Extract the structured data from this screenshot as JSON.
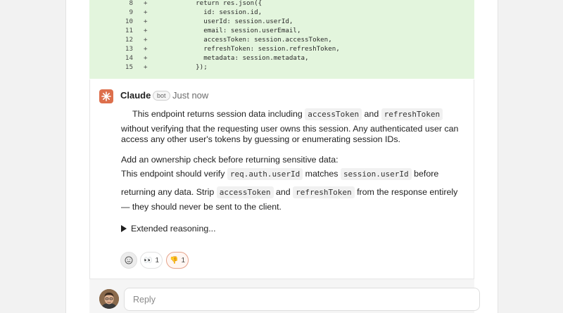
{
  "diff": {
    "lines": [
      {
        "num": "8",
        "sign": "+",
        "code": "    return res.json({"
      },
      {
        "num": "9",
        "sign": "+",
        "code": "      id: session.id,"
      },
      {
        "num": "10",
        "sign": "+",
        "code": "      userId: session.userId,"
      },
      {
        "num": "11",
        "sign": "+",
        "code": "      email: session.userEmail,"
      },
      {
        "num": "12",
        "sign": "+",
        "code": "      accessToken: session.accessToken,"
      },
      {
        "num": "13",
        "sign": "+",
        "code": "      refreshToken: session.refreshToken,"
      },
      {
        "num": "14",
        "sign": "+",
        "code": "      metadata: session.metadata,"
      },
      {
        "num": "15",
        "sign": "+",
        "code": "    });"
      }
    ]
  },
  "comment": {
    "author": "Claude",
    "badge": "bot",
    "timestamp": "Just now",
    "p1_a": "This endpoint returns session data including",
    "p1_code1": "accessToken",
    "p1_b": "and",
    "p1_code2": "refreshToken",
    "p1_line2": "without verifying that the requesting user owns this session. Any authenticated user can",
    "p1_line3": "access any other user's tokens by guessing or enumerating session IDs.",
    "p2_line1": "Add an ownership check before returning sensitive data:",
    "p2_a": "This endpoint should verify",
    "p2_code1": "req.auth.userId",
    "p2_b": "matches",
    "p2_code2": "session.userId",
    "p2_c": "before",
    "p2_d": "returning any data. Strip",
    "p2_code3": "accessToken",
    "p2_e": "and",
    "p2_code4": "refreshToken",
    "p2_f": "from the response entirely",
    "p2_line4": "— they should never be sent to the client.",
    "reasoning_label": "Extended reasoning..."
  },
  "reactions": {
    "eyes_glyph": "👀",
    "eyes_count": "1",
    "thumbs_down_glyph": "👎",
    "thumbs_down_count": "1"
  },
  "reply": {
    "placeholder": "Reply"
  },
  "colors": {
    "diff_added_bg": "#e3f5dd",
    "brand_orange": "#dd6f4c",
    "reaction_active_border": "#e6a38b"
  }
}
